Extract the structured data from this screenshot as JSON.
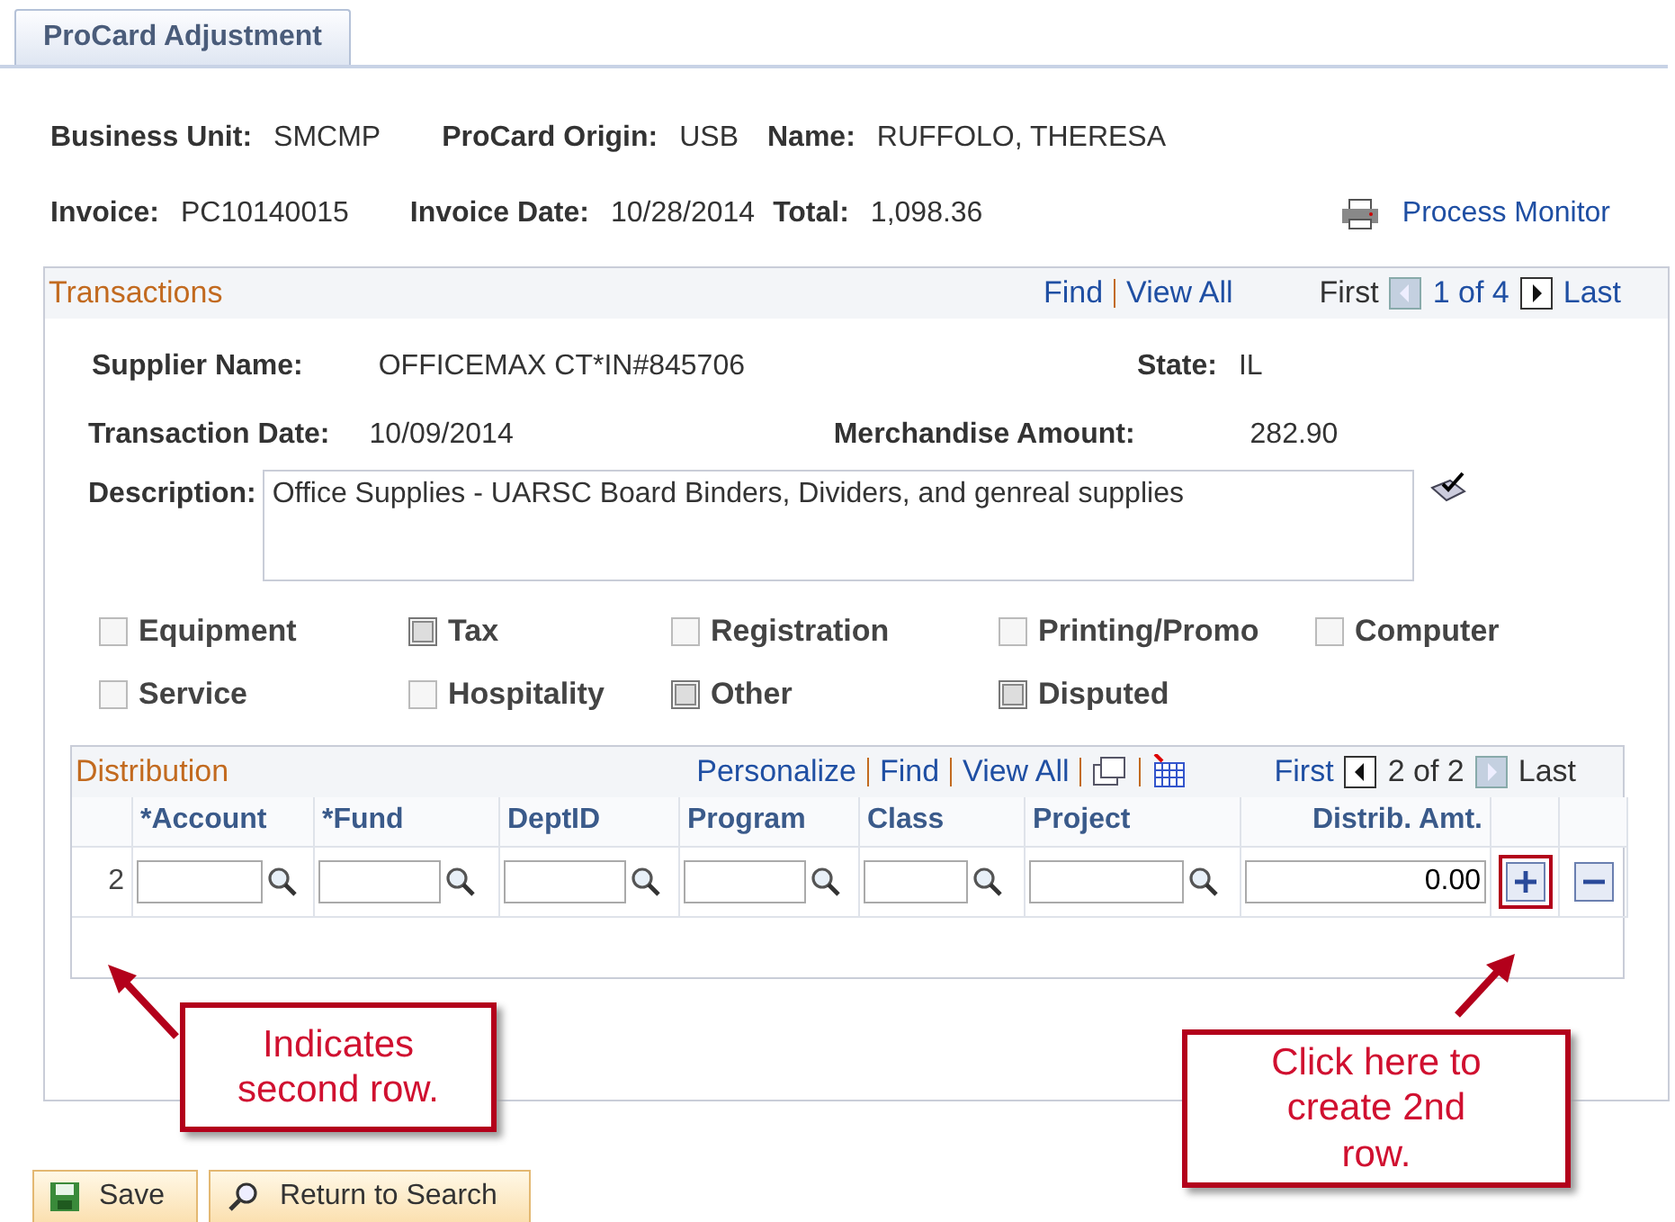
{
  "tab": {
    "label": "ProCard Adjustment",
    "selected": true
  },
  "header": [
    [
      {
        "label": "Business Unit:",
        "value": "SMCMP"
      },
      {
        "label": "ProCard Origin:",
        "value": "USB"
      },
      {
        "label": "Name:",
        "value": "RUFFOLO, THERESA"
      }
    ],
    [
      {
        "label": "Invoice:",
        "value": "PC10140015"
      },
      {
        "label": "Invoice Date:",
        "value": "10/28/2014"
      },
      {
        "label": "Total:",
        "value": "1,098.36"
      }
    ]
  ],
  "process_monitor": "Process Monitor",
  "transactions": {
    "title": "Transactions",
    "links": [
      "Find",
      "View All"
    ],
    "first": "First",
    "count": "1 of 4",
    "last": "Last",
    "prev_enabled": false,
    "next_enabled": true,
    "supplier_label": "Supplier Name:",
    "supplier": "OFFICEMAX CT*IN#845706",
    "state_label": "State:",
    "state": "IL",
    "date_label": "Transaction Date:",
    "date": "10/09/2014",
    "amount_label": "Merchandise Amount:",
    "amount": "282.90",
    "description_label": "Description:",
    "description": "Office Supplies - UARSC Board Binders, Dividers, and genreal supplies",
    "checkboxes": [
      {
        "label": "Equipment",
        "checked": false
      },
      {
        "label": "Tax",
        "checked": true
      },
      {
        "label": "Registration",
        "checked": false
      },
      {
        "label": "Printing/Promo",
        "checked": false
      },
      {
        "label": "Computer",
        "checked": false
      },
      {
        "label": "Service",
        "checked": false
      },
      {
        "label": "Hospitality",
        "checked": false
      },
      {
        "label": "Other",
        "checked": true
      },
      {
        "label": "Disputed",
        "checked": true
      }
    ]
  },
  "distribution": {
    "title": "Distribution",
    "links": [
      "Personalize",
      "Find",
      "View All"
    ],
    "first": "First",
    "count": "2 of 2",
    "last": "Last",
    "prev_enabled": true,
    "next_enabled": false,
    "columns": [
      "*Account",
      "*Fund",
      "DeptID",
      "Program",
      "Class",
      "Project",
      "Distrib. Amt."
    ],
    "row": {
      "number": "2",
      "amount": "0.00"
    }
  },
  "callouts": [
    {
      "text": "Indicates second row."
    },
    {
      "text": "Click here to create 2nd row."
    }
  ],
  "buttons": [
    {
      "kind": "save",
      "label": "Save"
    },
    {
      "kind": "search",
      "label": "Return to Search"
    }
  ]
}
